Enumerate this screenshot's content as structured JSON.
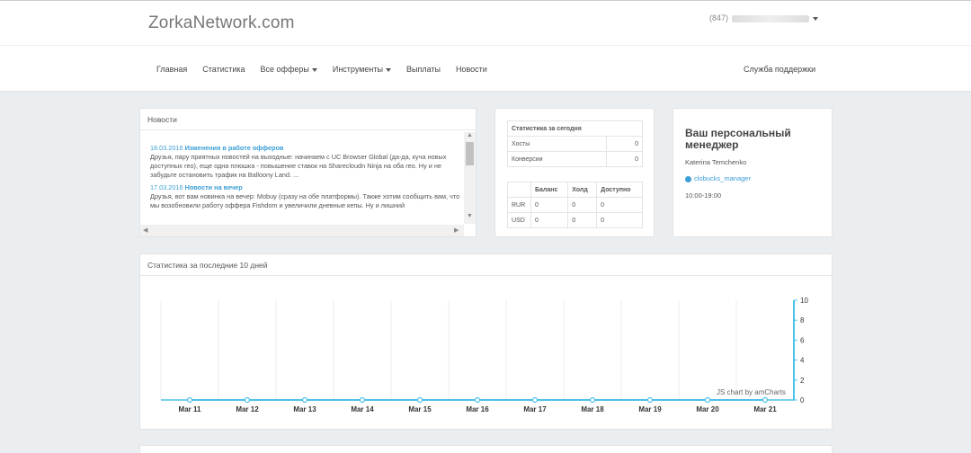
{
  "header": {
    "logo": "ZorkaNetwork.com",
    "user_prefix": "(847)"
  },
  "nav": {
    "items": [
      {
        "label": "Главная",
        "dropdown": false
      },
      {
        "label": "Статистика",
        "dropdown": false
      },
      {
        "label": "Все офферы",
        "dropdown": true
      },
      {
        "label": "Инструменты",
        "dropdown": true
      },
      {
        "label": "Выплаты",
        "dropdown": false
      },
      {
        "label": "Новости",
        "dropdown": false
      }
    ],
    "support": "Служба поддержки"
  },
  "news": {
    "title": "Новости",
    "entries": [
      {
        "date": "18.03.2016",
        "headline": "Изменения в работе офферов",
        "text": "Друзья, пару приятных новостей на выходные: начинаем с UC Browser Global (да-да, куча новых доступных гео), еще одна плюшка - повышение ставок на Sharecloudn Ninja на оба гео. Ну и не забудьте остановить трафик на Balloony Land. ..."
      },
      {
        "date": "17.03.2016",
        "headline": "Новости на вечер",
        "text": "Друзья, вот вам новинка на вечер: Mobuy (сразу на обе платформы). Также хотим сообщить вам, что мы возобновили работу оффера Fishdom и увеличили дневные кепы. Ну и лишний"
      }
    ]
  },
  "today_stats": {
    "title": "Статистика за сегодня",
    "rows": [
      {
        "label": "Хосты",
        "value": "0"
      },
      {
        "label": "Конверсии",
        "value": "0"
      }
    ],
    "balance_headers": [
      "",
      "Баланс",
      "Холд",
      "Доступно"
    ],
    "balance_rows": [
      [
        "RUR",
        "0",
        "0",
        "0"
      ],
      [
        "USD",
        "0",
        "0",
        "0"
      ]
    ]
  },
  "manager": {
    "title": "Ваш персональный менеджер",
    "name": "Katerina Temchenko",
    "skype": "clobucks_manager",
    "hours": "10:00-19:00"
  },
  "chart_panel": {
    "title": "Статистика за последние 10 дней",
    "watermark": "JS chart by amCharts"
  },
  "chart_data": {
    "type": "line",
    "title": "Статистика за последние 10 дней",
    "categories": [
      "Mar 11",
      "Mar 12",
      "Mar 13",
      "Mar 14",
      "Mar 15",
      "Mar 16",
      "Mar 17",
      "Mar 18",
      "Mar 19",
      "Mar 20",
      "Mar 21"
    ],
    "series": [
      {
        "values": [
          0,
          0,
          0,
          0,
          0,
          0,
          0,
          0,
          0,
          0,
          0
        ],
        "color": "#4fc1e9"
      }
    ],
    "yticks": [
      0,
      2,
      4,
      6,
      8,
      10
    ],
    "ylim": [
      0,
      10
    ],
    "y_axis_position": "right",
    "grid": true
  },
  "colors": {
    "link": "#3b9fd6",
    "accent": "#4fc1e9",
    "background": "#ebeef1"
  }
}
